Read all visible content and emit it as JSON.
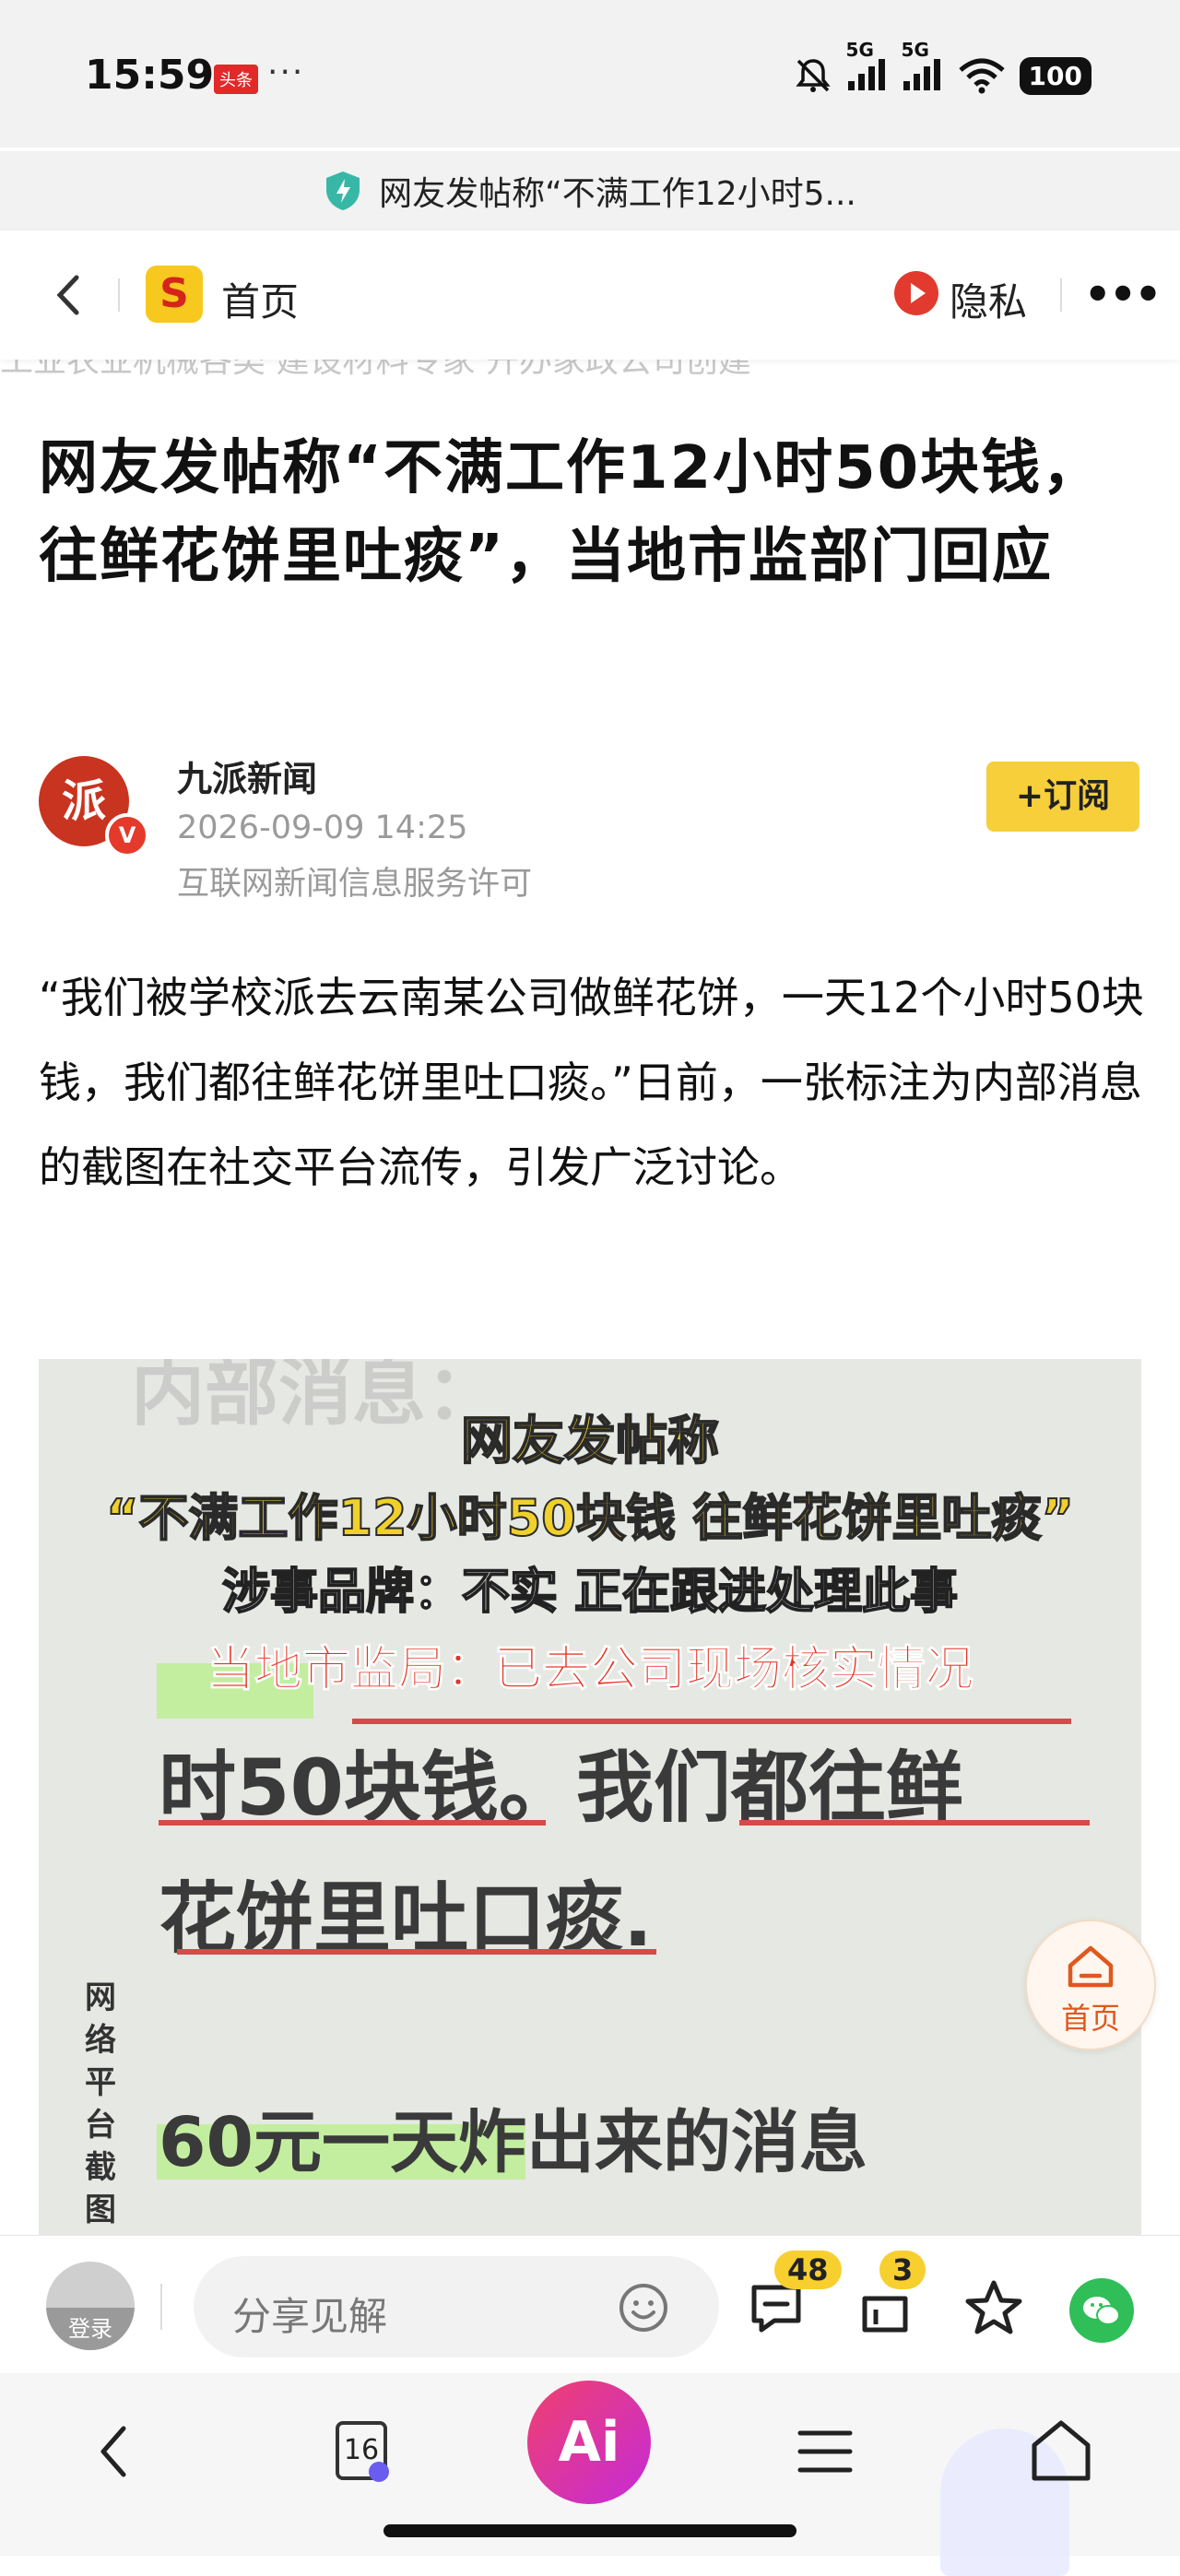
{
  "status_bar": {
    "time": "15:59",
    "app_badge": "头条",
    "dots": "···",
    "net1": "5G",
    "net2": "5G",
    "battery": "100",
    "page_title": "网友发帖称“不满工作12小时5..."
  },
  "nav": {
    "home_logo_letter": "S",
    "home_label": "首页",
    "privacy_label": "隐私",
    "more": "•••",
    "ghost_strip": "   工业农业机械各类            建设材料专家            开办家政公司创建"
  },
  "article": {
    "title": "网友发帖称“不满工作12小时50块钱，往鲜花饼里吐痰”，当地市监部门回应",
    "author": {
      "avatar_text": "派",
      "verified_badge": "V",
      "name": "九派新闻",
      "date": "2026-09-09 14:25",
      "license": "互联网新闻信息服务许可",
      "subscribe_label": "+订阅"
    },
    "paragraph": "“我们被学校派去云南某公司做鲜花饼，一天12个小时50块钱，我们都往鲜花饼里吐口痰。”日前，一张标注为内部消息的截图在社交平台流传，引发广泛讨论。"
  },
  "image": {
    "ghost_top": "内部消息：",
    "headline_1": "网友发帖称",
    "headline_2": "“不满工作12小时50块钱 往鲜花饼里吐痰”",
    "headline_3": "涉事品牌：不实 正在跟进处理此事",
    "headline_4": "当地市监局：已去公司现场核实情况",
    "line_1": "时50块钱。我们都往鲜",
    "line_2": "花饼里吐口痰.",
    "line_3": "60元一天炸出来的消息",
    "side_caption": "网络平台截图"
  },
  "float_home": {
    "label": "首页"
  },
  "comment_bar": {
    "login_label": "登录",
    "placeholder": "分享见解",
    "comment_count": "48",
    "share_count": "3"
  },
  "bottom_nav": {
    "tab_count": "16",
    "ai_label": "Ai"
  },
  "colors": {
    "accent_yellow": "#f6cf3b",
    "brand_red": "#e33a2b",
    "wechat_green": "#2fbe57",
    "ai_gradient_start": "#f0406e",
    "ai_gradient_end": "#c52bd8"
  }
}
